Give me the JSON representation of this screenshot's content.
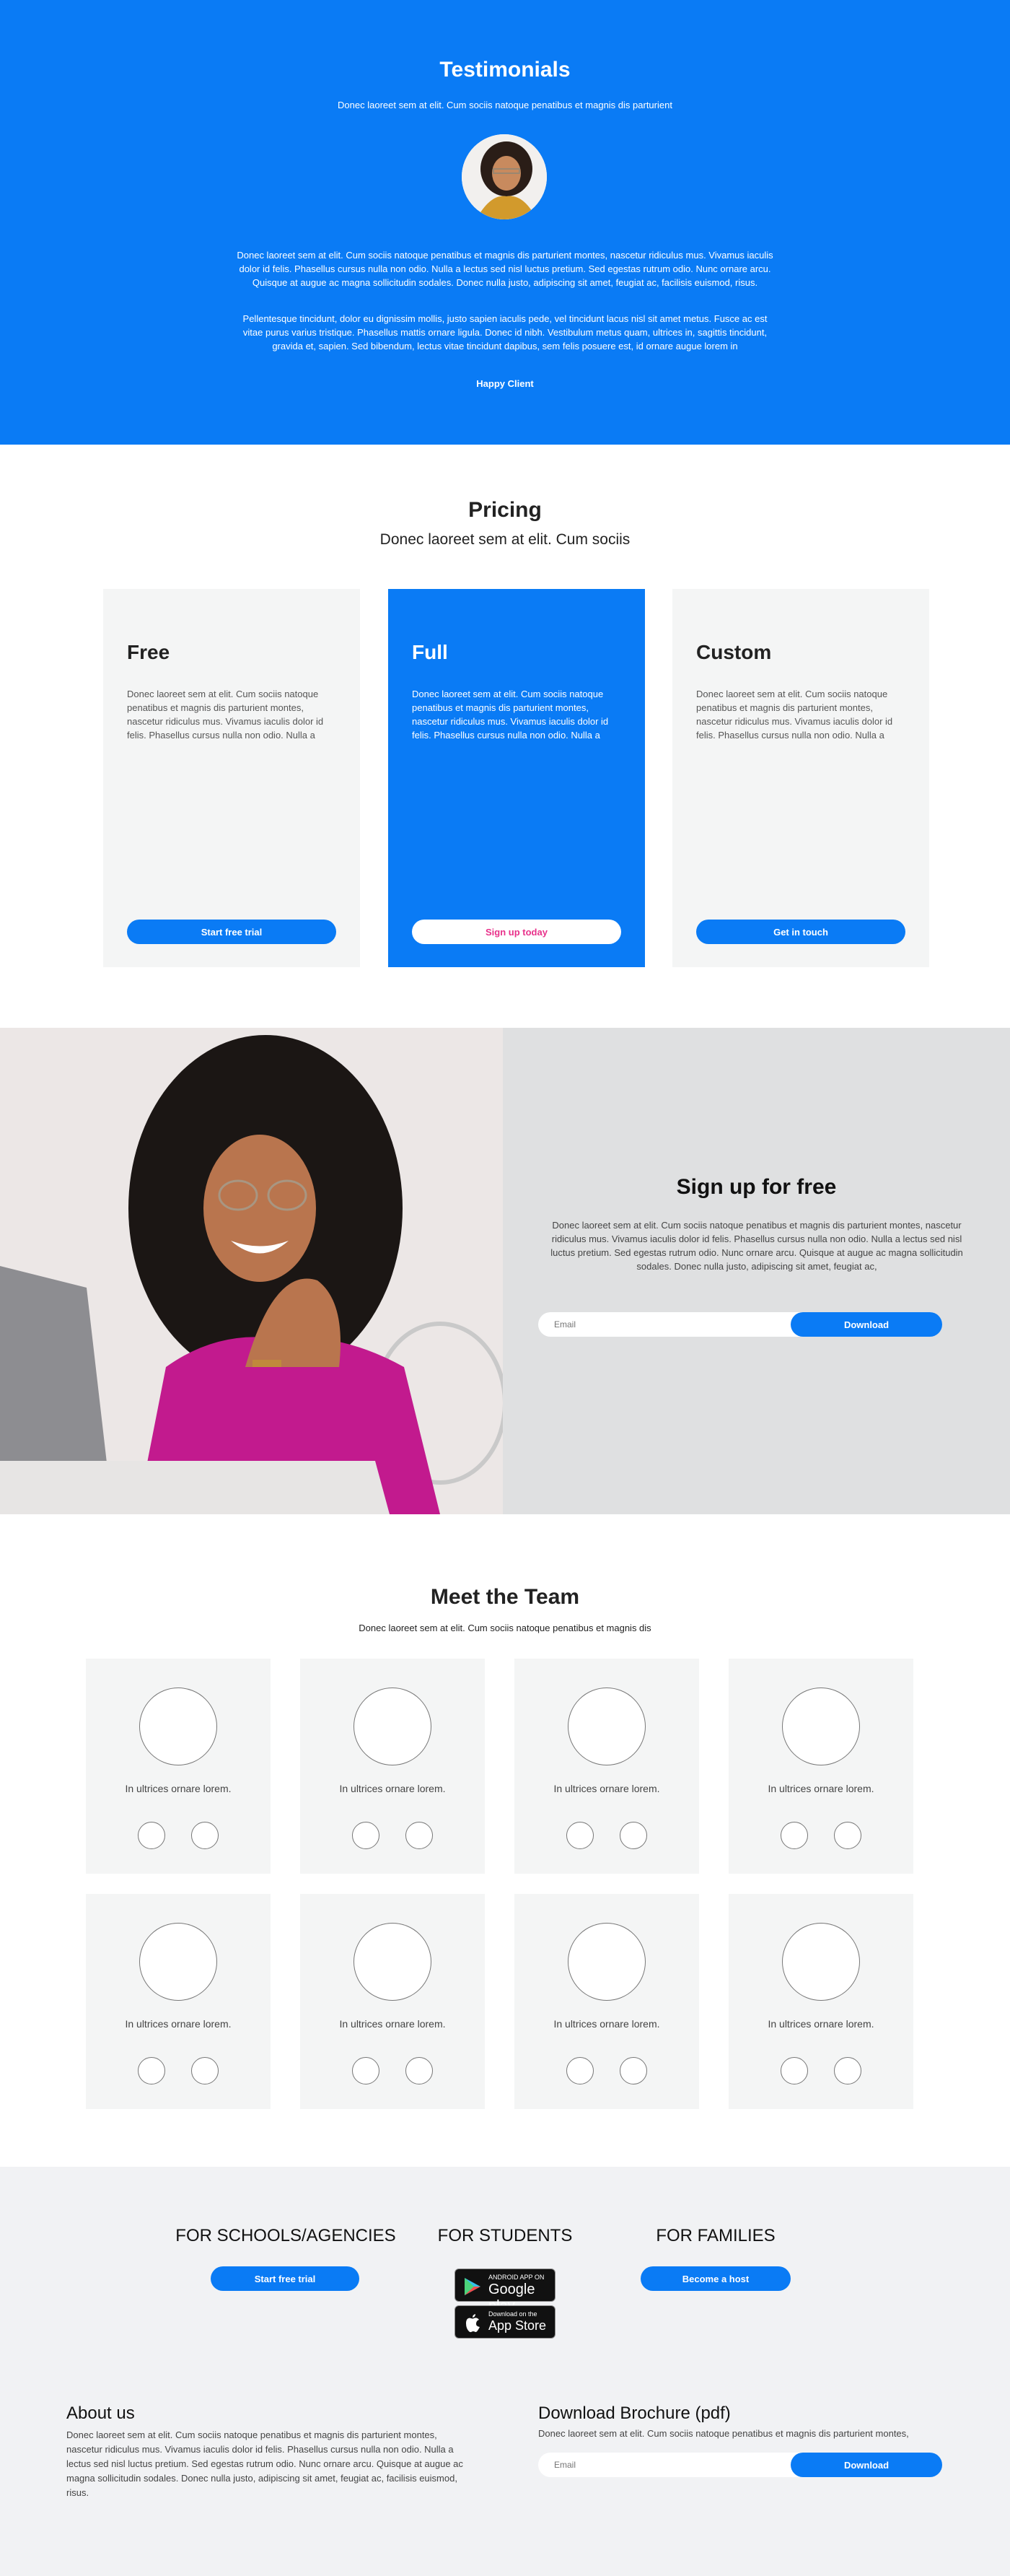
{
  "testimonials": {
    "title": "Testimonials",
    "subtitle": "Donec laoreet sem at elit. Cum sociis natoque penatibus et magnis dis parturient",
    "paragraph_1": "Donec laoreet sem at elit. Cum sociis natoque penatibus et magnis dis parturient montes, nascetur ridiculus mus. Vivamus iaculis dolor id felis. Phasellus cursus nulla non odio. Nulla a lectus sed nisl luctus pretium. Sed egestas rutrum odio. Nunc ornare arcu. Quisque at augue ac magna sollicitudin sodales. Donec nulla justo, adipiscing sit amet, feugiat ac, facilisis euismod, risus.",
    "paragraph_2": "Pellentesque tincidunt, dolor eu dignissim mollis, justo sapien iaculis pede, vel tincidunt lacus nisl sit amet metus. Fusce ac est vitae purus varius tristique. Phasellus mattis ornare ligula. Donec id nibh. Vestibulum metus quam, ultrices in, sagittis tincidunt, gravida et, sapien. Sed bibendum, lectus vitae tincidunt dapibus, sem felis posuere est, id ornare augue lorem in",
    "author": "Happy Client"
  },
  "pricing": {
    "title": "Pricing",
    "subtitle": "Donec laoreet sem at elit. Cum sociis",
    "plans": [
      {
        "name": "Free",
        "description": "Donec laoreet sem at elit. Cum sociis natoque penatibus et magnis dis parturient montes, nascetur ridiculus mus. Vivamus iaculis dolor id felis. Phasellus cursus nulla non odio. Nulla a",
        "button": "Start free trial"
      },
      {
        "name": "Full",
        "description": "Donec laoreet sem at elit. Cum sociis natoque penatibus et magnis dis parturient montes, nascetur ridiculus mus. Vivamus iaculis dolor id felis. Phasellus cursus nulla non odio. Nulla a",
        "button": "Sign up today"
      },
      {
        "name": "Custom",
        "description": "Donec laoreet sem at elit. Cum sociis natoque penatibus et magnis dis parturient montes, nascetur ridiculus mus. Vivamus iaculis dolor id felis. Phasellus cursus nulla non odio. Nulla a",
        "button": "Get in touch"
      }
    ]
  },
  "signup": {
    "title": "Sign up for free",
    "text": "Donec laoreet sem at elit. Cum sociis natoque penatibus et magnis dis parturient montes, nascetur ridiculus mus. Vivamus iaculis dolor id felis. Phasellus cursus nulla non odio. Nulla a lectus sed nisl luctus pretium. Sed egestas rutrum odio. Nunc ornare arcu. Quisque at augue ac magna sollicitudin sodales. Donec nulla justo, adipiscing sit amet, feugiat ac,",
    "email_placeholder": "Email",
    "button": "Download"
  },
  "team": {
    "title": "Meet the Team",
    "subtitle": "Donec laoreet sem at elit. Cum sociis natoque penatibus et magnis dis",
    "members": [
      {
        "name": "In ultrices ornare lorem."
      },
      {
        "name": "In ultrices ornare lorem."
      },
      {
        "name": "In ultrices ornare lorem."
      },
      {
        "name": "In ultrices ornare lorem."
      },
      {
        "name": "In ultrices ornare lorem."
      },
      {
        "name": "In ultrices ornare lorem."
      },
      {
        "name": "In ultrices ornare lorem."
      },
      {
        "name": "In ultrices ornare lorem."
      }
    ]
  },
  "footer": {
    "schools": {
      "title": "FOR SCHOOLS/AGENCIES",
      "button": "Start free trial"
    },
    "students": {
      "title": "FOR STUDENTS",
      "google_small": "ANDROID APP ON",
      "google_big": "Google play",
      "apple_small": "Download on the",
      "apple_big": "App Store"
    },
    "families": {
      "title": "FOR FAMILIES",
      "button": "Become a host"
    },
    "about": {
      "title": "About us",
      "text": "Donec laoreet sem at elit. Cum sociis natoque penatibus et magnis dis parturient montes, nascetur ridiculus mus. Vivamus iaculis dolor id felis. Phasellus cursus nulla non odio. Nulla a lectus sed nisl luctus pretium. Sed egestas rutrum odio. Nunc ornare arcu. Quisque at augue ac magna sollicitudin sodales. Donec nulla justo, adipiscing sit amet, feugiat ac, facilisis euismod, risus."
    },
    "brochure": {
      "title": "Download Brochure (pdf)",
      "text": "Donec laoreet sem at elit. Cum sociis natoque penatibus et magnis dis parturient montes,",
      "email_placeholder": "Email",
      "button": "Download"
    }
  },
  "colors": {
    "accent": "#0a7bf5",
    "highlight_text": "#e8318a",
    "card_bg": "#f4f5f5",
    "footer_bg": "#f1f2f4"
  }
}
